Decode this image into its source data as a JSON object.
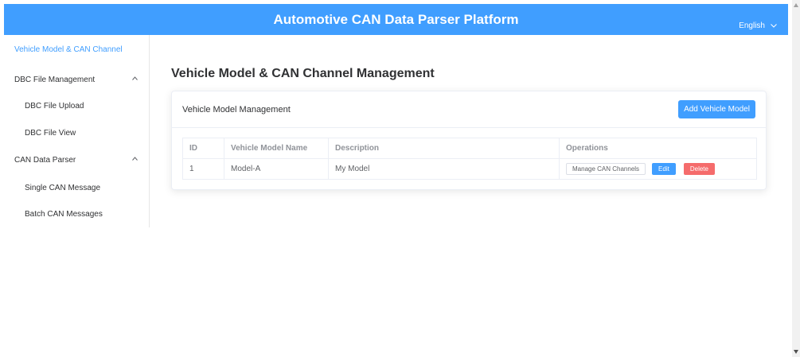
{
  "header": {
    "title": "Automotive CAN Data Parser Platform",
    "language": "English"
  },
  "sidebar": {
    "items": [
      {
        "label": "Vehicle Model & CAN Channel"
      },
      {
        "label": "DBC File Management"
      },
      {
        "label": "DBC File Upload"
      },
      {
        "label": "DBC File View"
      },
      {
        "label": "CAN Data Parser"
      },
      {
        "label": "Single CAN Message"
      },
      {
        "label": "Batch CAN Messages"
      }
    ]
  },
  "main": {
    "title": "Vehicle Model & CAN Channel Management",
    "card": {
      "title": "Vehicle Model Management",
      "add_button": "Add Vehicle Model"
    },
    "table": {
      "columns": [
        "ID",
        "Vehicle Model Name",
        "Description",
        "Operations"
      ],
      "rows": [
        {
          "id": "1",
          "name": "Model-A",
          "description": "My Model"
        }
      ],
      "actions": {
        "manage": "Manage CAN Channels",
        "edit": "Edit",
        "delete": "Delete"
      }
    }
  },
  "colors": {
    "primary": "#409eff",
    "danger": "#f56c6c"
  }
}
